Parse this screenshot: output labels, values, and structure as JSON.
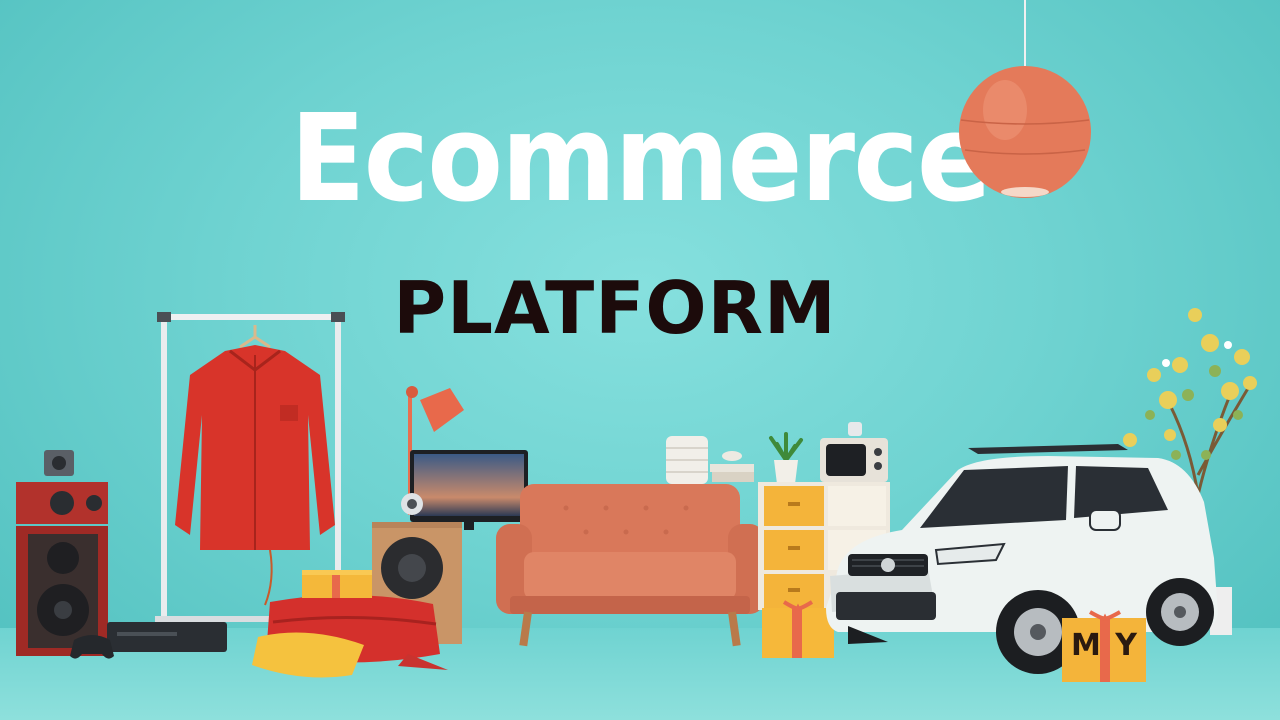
{
  "title": "Ecommerce",
  "subtitle": "PLATFORM",
  "gift_box_letters": "M Y",
  "colors": {
    "wall": "#6fd3d1",
    "title_text": "#ffffff",
    "subtitle_text": "#1c0b0b",
    "accent_orange": "#e8694b",
    "shirt_red": "#d8342a",
    "sofa": "#d9785a",
    "drawer_yellow": "#f4b43a",
    "car_white": "#eef3f2"
  },
  "icons": [
    "pendant-lamp-icon",
    "clothing-rack-icon",
    "red-shirt-icon",
    "speaker-icon",
    "desk-lamp-icon",
    "monitor-icon",
    "sofa-icon",
    "drawer-cabinet-icon",
    "retro-tv-icon",
    "potted-plant-icon",
    "flowering-tree-icon",
    "suv-car-icon",
    "gift-box-icon",
    "pillow-icon",
    "gamepad-icon",
    "dvd-player-icon"
  ]
}
